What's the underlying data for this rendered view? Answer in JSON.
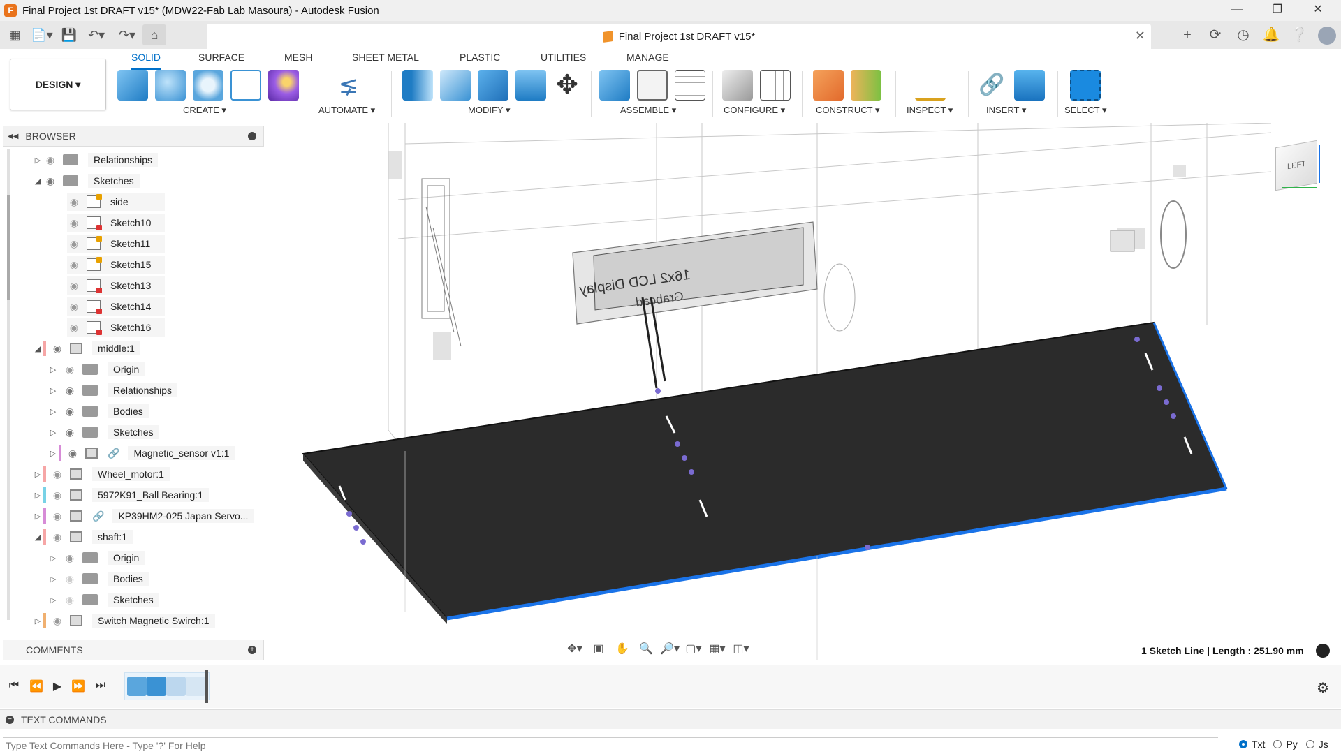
{
  "window": {
    "title": "Final Project 1st DRAFT v15* (MDW22-Fab Lab Masoura) - Autodesk Fusion",
    "app_icon": "F"
  },
  "document_tab": {
    "title": "Final Project 1st DRAFT v15*"
  },
  "ribbon": {
    "workspace": "DESIGN",
    "tabs": [
      "SOLID",
      "SURFACE",
      "MESH",
      "SHEET METAL",
      "PLASTIC",
      "UTILITIES",
      "MANAGE"
    ],
    "active_tab": "SOLID",
    "groups": [
      "CREATE",
      "AUTOMATE",
      "MODIFY",
      "ASSEMBLE",
      "CONFIGURE",
      "CONSTRUCT",
      "INSPECT",
      "INSERT",
      "SELECT"
    ]
  },
  "browser": {
    "title": "BROWSER",
    "items": [
      {
        "label": "Relationships",
        "icon": "folder-icon",
        "color": ""
      },
      {
        "label": "Sketches",
        "icon": "folder-icon",
        "color": ""
      },
      {
        "label": "side",
        "icon": "sketch-icon",
        "color": ""
      },
      {
        "label": "Sketch10",
        "icon": "sketch-icon",
        "color": ""
      },
      {
        "label": "Sketch11",
        "icon": "sketch-icon",
        "color": ""
      },
      {
        "label": "Sketch15",
        "icon": "sketch-icon",
        "color": ""
      },
      {
        "label": "Sketch13",
        "icon": "sketch-icon",
        "color": ""
      },
      {
        "label": "Sketch14",
        "icon": "sketch-icon",
        "color": ""
      },
      {
        "label": "Sketch16",
        "icon": "sketch-icon",
        "color": ""
      },
      {
        "label": "middle:1",
        "icon": "component-icon",
        "color": "#f6a6a6"
      },
      {
        "label": "Origin",
        "icon": "folder-icon",
        "color": ""
      },
      {
        "label": "Relationships",
        "icon": "folder-icon",
        "color": ""
      },
      {
        "label": "Bodies",
        "icon": "folder-icon",
        "color": ""
      },
      {
        "label": "Sketches",
        "icon": "folder-icon",
        "color": ""
      },
      {
        "label": "Magnetic_sensor v1:1",
        "icon": "linked-component-icon",
        "color": "#d78cd7"
      },
      {
        "label": "Wheel_motor:1",
        "icon": "component-icon",
        "color": "#f6a6a6"
      },
      {
        "label": "5972K91_Ball Bearing:1",
        "icon": "component-icon",
        "color": "#78d2e6"
      },
      {
        "label": "KP39HM2-025 Japan Servo...",
        "icon": "linked-component-icon",
        "color": "#d78cd7"
      },
      {
        "label": "shaft:1",
        "icon": "component-icon",
        "color": "#f6a6a6"
      },
      {
        "label": "Origin",
        "icon": "folder-icon",
        "color": ""
      },
      {
        "label": "Bodies",
        "icon": "folder-icon",
        "color": ""
      },
      {
        "label": "Sketches",
        "icon": "folder-icon",
        "color": ""
      },
      {
        "label": "Switch Magnetic Swirch:1",
        "icon": "component-icon",
        "color": "#f0b070"
      }
    ]
  },
  "viewcube": {
    "face": "LEFT"
  },
  "viewport_model": {
    "lcd_text_1": "16x2 LCD Display",
    "lcd_text_2": "Grabcad"
  },
  "comments": {
    "title": "COMMENTS"
  },
  "status": {
    "text": "1 Sketch Line | Length : 251.90 mm"
  },
  "text_commands": {
    "title": "TEXT COMMANDS",
    "placeholder": "Type Text Commands Here - Type '?' For Help",
    "options": [
      "Txt",
      "Py",
      "Js"
    ],
    "selected_option": "Txt"
  }
}
